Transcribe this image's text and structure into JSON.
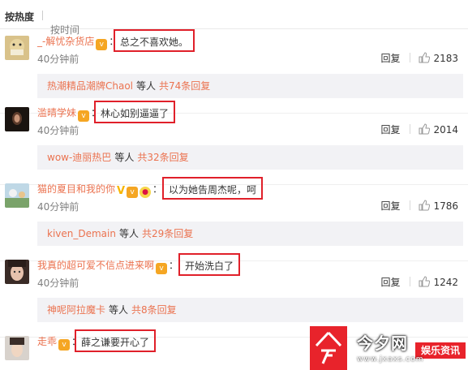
{
  "sort_bar": {
    "hot_label": "按热度",
    "time_label": "按时间"
  },
  "comments": [
    {
      "username": "_-解忧杂货店",
      "text": "总之不喜欢她。",
      "time": "40分钟前",
      "reply_label": "回复",
      "likes": "2183",
      "replies": {
        "names": "热潮精品潮牌Chaol",
        "etc": "等人",
        "count": "共74条回复"
      }
    },
    {
      "username": "滥晴学妹",
      "text": "林心如别逼逼了",
      "time": "40分钟前",
      "reply_label": "回复",
      "likes": "2014",
      "replies": {
        "names": "wow-迪丽热巴",
        "etc": "等人",
        "count": "共32条回复"
      }
    },
    {
      "username": "猫的夏目和我的你",
      "text": "以为她告周杰呢，呵",
      "time": "40分钟前",
      "reply_label": "回复",
      "likes": "1786",
      "replies": {
        "names": "kiven_Demain",
        "etc": "等人",
        "count": "共29条回复"
      }
    },
    {
      "username": "我真的超可爱不信点进来啊",
      "text": "开始洗白了",
      "time": "40分钟前",
      "reply_label": "回复",
      "likes": "1242",
      "replies": {
        "names": "神呢阿拉魔卡",
        "etc": "等人",
        "count": "共8条回复"
      }
    },
    {
      "username": "走乖",
      "text": "薛之谦要开心了",
      "time": "",
      "reply_label": "",
      "likes": "",
      "replies": null
    }
  ],
  "watermark": {
    "name": "今夕网",
    "tag": "娱乐资讯",
    "url": "www.jxaxs.com"
  },
  "colors": {
    "username": "#eb7350",
    "highlight_box": "#e0202a",
    "reply_bg": "#f2f2f5",
    "watermark_red": "#e8232b"
  },
  "icons": [
    "thumbs-up-icon",
    "vip-badge-icon",
    "verified-v-icon",
    "bulb-badge-icon"
  ]
}
